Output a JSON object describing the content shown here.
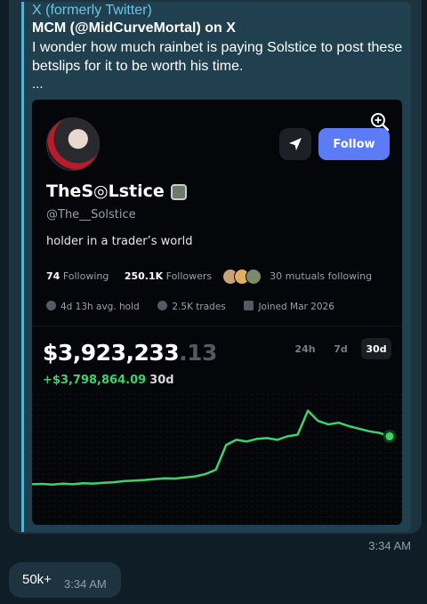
{
  "link_preview": {
    "site_name": "X (formerly Twitter)",
    "author": "MCM (@MidCurveMortal) on X",
    "text": "I wonder how much rainbet is paying Solstice to post these betslips for it to be worth his time.",
    "ellipsis": "..."
  },
  "profile": {
    "display_name": "TheS◎Lstice",
    "handle": "@The__Solstice",
    "bio": "holder in a trader’s world",
    "follow_label": "Follow",
    "following_count": "74",
    "following_label": "Following",
    "followers_count": "250.1K",
    "followers_label": "Followers",
    "mutuals_label": "30 mutuals following",
    "avg_hold": "4d 13h avg. hold",
    "trades": "2.5K trades",
    "joined": "Joined Mar 2026",
    "balance_main": "$3,923,233",
    "balance_decimals": ".13",
    "pnl_value": "+$3,798,864.09",
    "pnl_period": "30d",
    "ranges": [
      "24h",
      "7d",
      "30d"
    ],
    "active_range": "30d",
    "accent_color": "#5b7cf6",
    "positive_color": "#3dd26a"
  },
  "chart_data": {
    "type": "line",
    "title": "",
    "xlabel": "",
    "ylabel": "",
    "series": [
      {
        "values": [
          5,
          5.2,
          4.8,
          5.3,
          5,
          5.6,
          5.4,
          5.8,
          6.2,
          6.8,
          7.2,
          7.5,
          8,
          8.4,
          8.3,
          9,
          9.6,
          11,
          13.5,
          28,
          31,
          30,
          31.5,
          32,
          31,
          33,
          34,
          48,
          42,
          40,
          41,
          39,
          37.5,
          36,
          35,
          33
        ]
      }
    ],
    "grid": false,
    "legend": "none"
  },
  "chat": {
    "message1_time": "3:34 AM",
    "message2_text": "50k+",
    "message2_time": "3:34 AM"
  },
  "icons": {
    "zoom": "zoom-in-icon",
    "send": "paper-plane-icon",
    "verified_badge": "badge-icon",
    "hold": "clock-icon",
    "trades": "coin-icon",
    "joined": "calendar-icon"
  }
}
